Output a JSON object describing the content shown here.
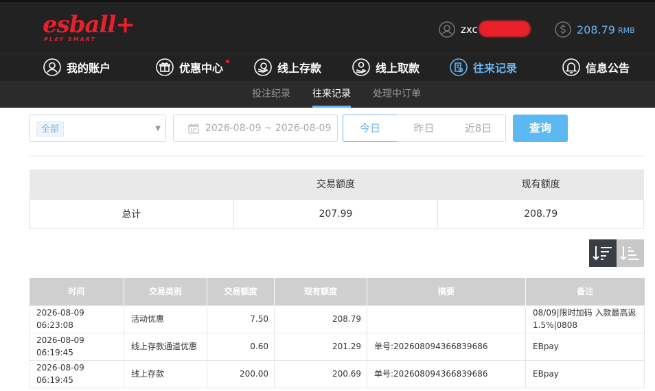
{
  "logo": {
    "main": "esball+",
    "sub": "PLAY SMART"
  },
  "user": {
    "name": "zxc",
    "icon": "user-icon"
  },
  "balance": {
    "amount": "208.79",
    "unit": "RMB",
    "icon": "dollar-icon"
  },
  "nav": [
    {
      "label": "我的账户",
      "icon": "user-icon"
    },
    {
      "label": "优惠中心",
      "icon": "gift-icon"
    },
    {
      "label": "线上存款",
      "icon": "deposit-icon"
    },
    {
      "label": "线上取款",
      "icon": "withdraw-icon"
    },
    {
      "label": "往来记录",
      "icon": "records-icon"
    },
    {
      "label": "信息公告",
      "icon": "bell-icon"
    }
  ],
  "subnav": [
    "投注纪录",
    "往来记录",
    "处理中订单"
  ],
  "filter": {
    "category": "全部",
    "date_range": "2026-08-09 ~ 2026-08-09",
    "today": "今日",
    "yesterday": "昨日",
    "last8": "近8日",
    "query": "查询"
  },
  "summary": {
    "headers": [
      "",
      "交易额度",
      "现有额度"
    ],
    "row": [
      "总计",
      "207.99",
      "208.79"
    ]
  },
  "records": {
    "headers": [
      "时间",
      "交易类别",
      "交易额度",
      "现有额度",
      "摘要",
      "备注"
    ],
    "rows": [
      [
        "2026-08-09 06:23:08",
        "活动优惠",
        "7.50",
        "208.79",
        "",
        "08/09|限时加码 入款最高返1.5%|0808"
      ],
      [
        "2026-08-09 06:19:45",
        "线上存款通道优惠",
        "0.60",
        "201.29",
        "单号:202608094366839686",
        "EBpay"
      ],
      [
        "2026-08-09 06:19:45",
        "线上存款",
        "200.00",
        "200.69",
        "单号:202608094366839686",
        "EBpay"
      ]
    ]
  },
  "colors": {
    "accent": "#6ab4f0",
    "brand": "#e8202a",
    "header_bg": "#222222"
  }
}
